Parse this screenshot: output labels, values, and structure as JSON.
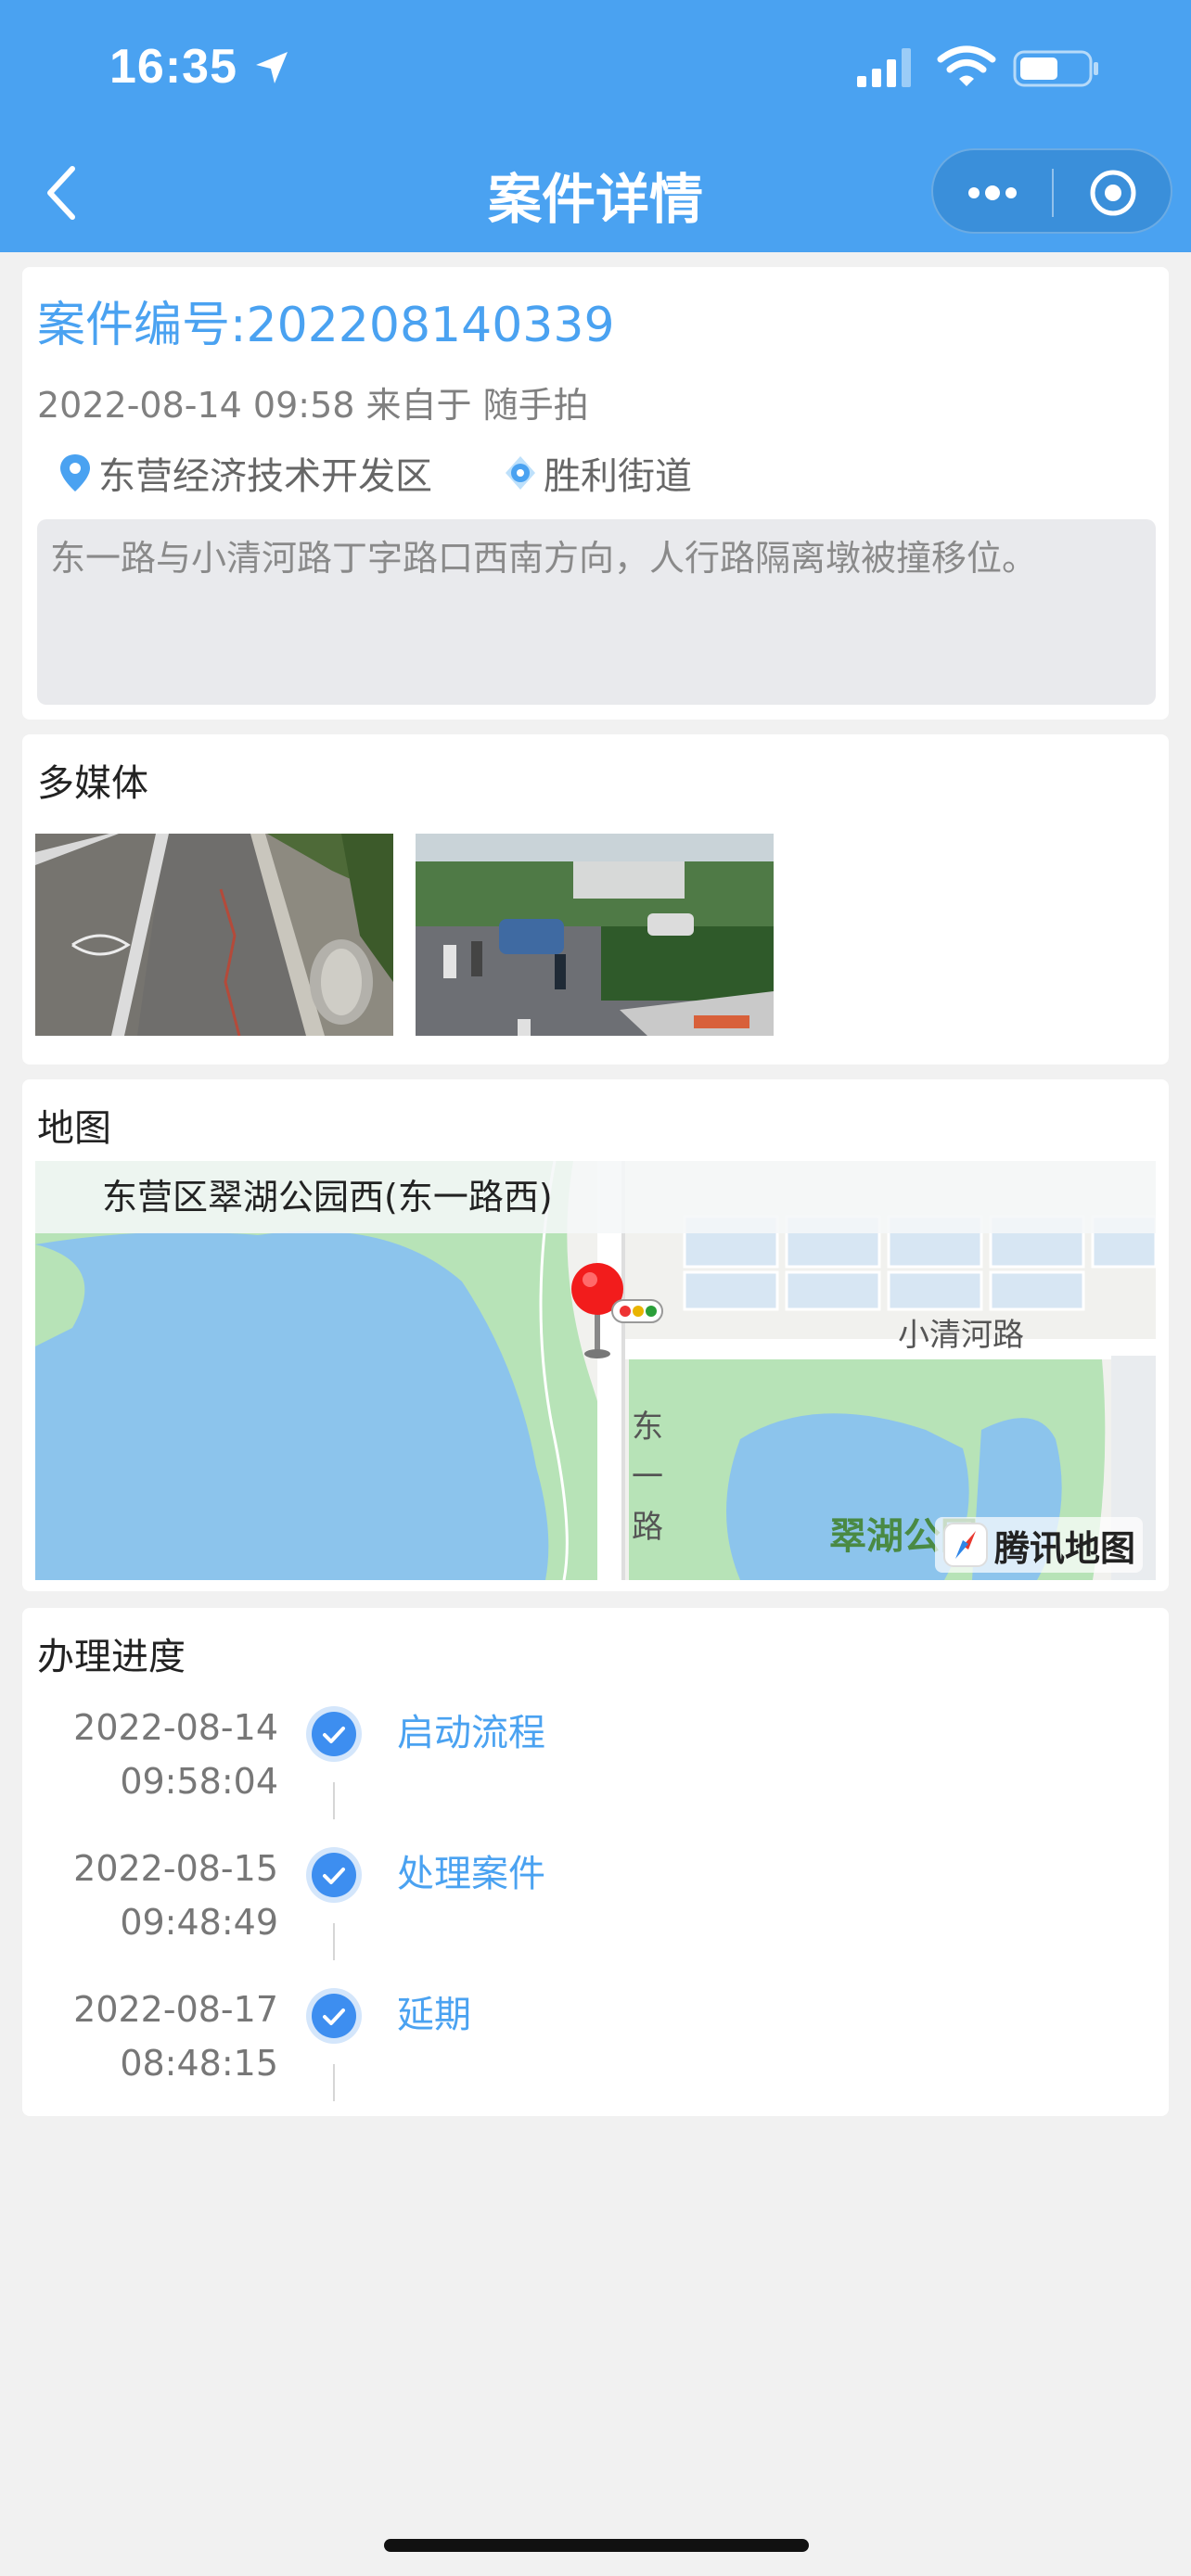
{
  "status_bar": {
    "time": "16:35"
  },
  "nav": {
    "title": "案件详情"
  },
  "case": {
    "number_label": "案件编号:202208140339",
    "meta": "2022-08-14 09:58 来自于 随手拍",
    "district": "东营经济技术开发区",
    "street": "胜利街道",
    "description": "东一路与小清河路丁字路口西南方向，人行路隔离墩被撞移位。"
  },
  "media": {
    "title": "多媒体"
  },
  "map": {
    "title": "地图",
    "address": "东营区翠湖公园西(东一路西)",
    "road_horizontal": "小清河路",
    "road_vertical": "东一路",
    "park": "翠湖公园",
    "logo_text": "腾讯地图"
  },
  "progress": {
    "title": "办理进度",
    "steps": [
      {
        "date": "2022-08-14",
        "time": "09:58:04",
        "label": "启动流程"
      },
      {
        "date": "2022-08-15",
        "time": "09:48:49",
        "label": "处理案件"
      },
      {
        "date": "2022-08-17",
        "time": "08:48:15",
        "label": "延期"
      }
    ]
  },
  "colors": {
    "accent": "#4aa2f1",
    "header_bg": "#4aa2f1",
    "page_bg": "#f1f1f1",
    "description_bg": "#e9eaed"
  },
  "icons": {
    "location_arrow": "location-arrow-icon",
    "signal": "cellular-signal-icon",
    "wifi": "wifi-icon",
    "battery": "battery-icon",
    "back": "chevron-left-icon",
    "more": "more-dots-icon",
    "close": "target-close-icon",
    "district_pin": "map-pin-icon",
    "street_pin": "location-target-icon",
    "step_done": "check-circle-icon",
    "map_marker": "map-marker-icon"
  }
}
